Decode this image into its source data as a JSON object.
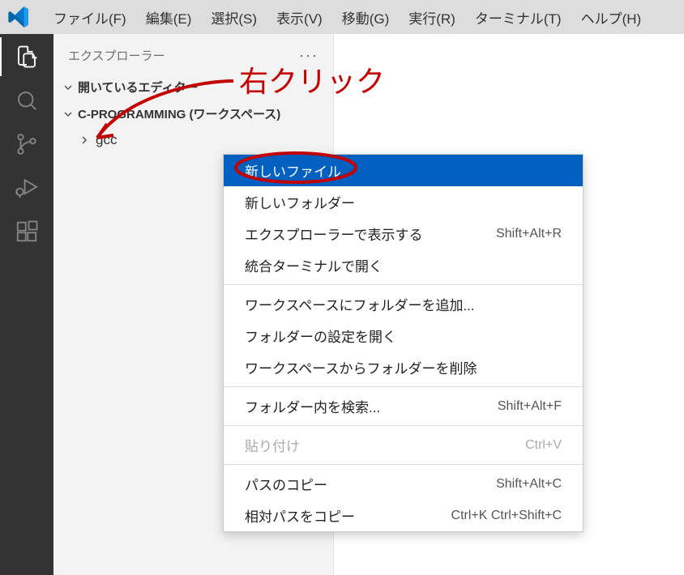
{
  "menubar": {
    "items": [
      "ファイル(F)",
      "編集(E)",
      "選択(S)",
      "表示(V)",
      "移動(G)",
      "実行(R)",
      "ターミナル(T)",
      "ヘルプ(H)"
    ]
  },
  "sidebar": {
    "title": "エクスプローラー",
    "open_editors_label": "開いているエディター",
    "workspace_label": "C-PROGRAMMING (ワークスペース)",
    "folder_name": "gcc"
  },
  "context_menu": {
    "items": [
      {
        "label": "新しいファイル",
        "shortcut": "",
        "selected": true,
        "disabled": false
      },
      {
        "label": "新しいフォルダー",
        "shortcut": "",
        "selected": false,
        "disabled": false
      },
      {
        "label": "エクスプローラーで表示する",
        "shortcut": "Shift+Alt+R",
        "selected": false,
        "disabled": false
      },
      {
        "label": "統合ターミナルで開く",
        "shortcut": "",
        "selected": false,
        "disabled": false
      },
      {
        "type": "divider"
      },
      {
        "label": "ワークスペースにフォルダーを追加...",
        "shortcut": "",
        "selected": false,
        "disabled": false
      },
      {
        "label": "フォルダーの設定を開く",
        "shortcut": "",
        "selected": false,
        "disabled": false
      },
      {
        "label": "ワークスペースからフォルダーを削除",
        "shortcut": "",
        "selected": false,
        "disabled": false
      },
      {
        "type": "divider"
      },
      {
        "label": "フォルダー内を検索...",
        "shortcut": "Shift+Alt+F",
        "selected": false,
        "disabled": false
      },
      {
        "type": "divider"
      },
      {
        "label": "貼り付け",
        "shortcut": "Ctrl+V",
        "selected": false,
        "disabled": true
      },
      {
        "type": "divider"
      },
      {
        "label": "パスのコピー",
        "shortcut": "Shift+Alt+C",
        "selected": false,
        "disabled": false
      },
      {
        "label": "相対パスをコピー",
        "shortcut": "Ctrl+K Ctrl+Shift+C",
        "selected": false,
        "disabled": false
      }
    ]
  },
  "annotation": {
    "text": "右クリック"
  }
}
